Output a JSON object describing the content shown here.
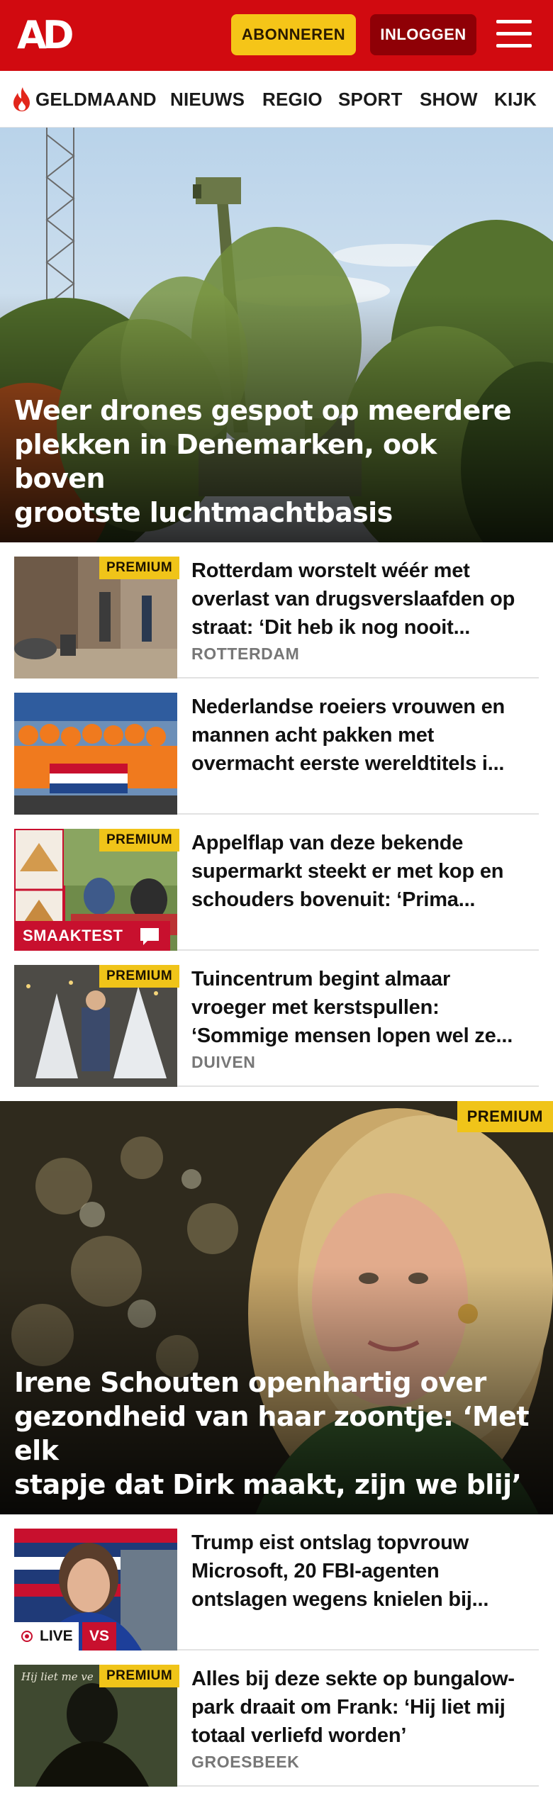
{
  "header": {
    "logo": "AD",
    "subscribe_label": "ABONNEREN",
    "login_label": "INLOGGEN",
    "menu_icon": "hamburger-menu-icon",
    "background_color": "#d10a10",
    "subscribe_color": "#f5c518"
  },
  "nav": {
    "items": [
      {
        "label": "GELDMAAND",
        "icon": "flame-icon"
      },
      {
        "label": "NIEUWS"
      },
      {
        "label": "REGIO"
      },
      {
        "label": "SPORT"
      },
      {
        "label": "SHOW"
      },
      {
        "label": "KIJK"
      }
    ]
  },
  "hero1": {
    "title_lines": [
      "Weer drones gespot op meerdere",
      "plekken in Denemarken, ook boven",
      "grootste luchtmachtbasis"
    ]
  },
  "articles": [
    {
      "premium": "PREMIUM",
      "title_lines": [
        "Rotterdam worstelt wéér met",
        "overlast van drugsverslaafden op",
        "straat: ‘Dit heb ik nog nooit..."
      ],
      "tag": "ROTTERDAM"
    },
    {
      "title_lines": [
        "Nederlandse roeiers vrouwen en",
        "mannen acht pakken met",
        "overmacht eerste wereldtitels i..."
      ]
    },
    {
      "premium": "PREMIUM",
      "badge": "SMAAKTEST",
      "badge_icon": "comment-icon",
      "title_lines": [
        "Appelflap van deze bekende",
        "supermarkt steekt er met kop en",
        "schouders bovenuit: ‘Prima..."
      ]
    },
    {
      "premium": "PREMIUM",
      "title_lines": [
        "Tuincentrum begint almaar",
        "vroeger met kerstspullen:",
        "‘Sommige mensen lopen wel ze..."
      ],
      "tag": "DUIVEN"
    }
  ],
  "hero2": {
    "premium": "PREMIUM",
    "title_lines": [
      "Irene Schouten openhartig over",
      "gezondheid van haar zoontje: ‘Met elk",
      "stapje dat Dirk maakt, zijn we blij’"
    ]
  },
  "articles2": [
    {
      "live": "LIVE",
      "vs": "VS",
      "title_lines": [
        "Trump eist ontslag topvrouw",
        "Microsoft, 20 FBI-agenten",
        "ontslagen wegens knielen bij..."
      ]
    },
    {
      "premium": "PREMIUM",
      "thumb_text": "Hij liet me ve",
      "title_lines": [
        "Alles bij deze sekte op bungalow-",
        "park draait om Frank: ‘Hij liet mij",
        "totaal verliefd worden’"
      ],
      "tag": "GROESBEEK"
    }
  ]
}
